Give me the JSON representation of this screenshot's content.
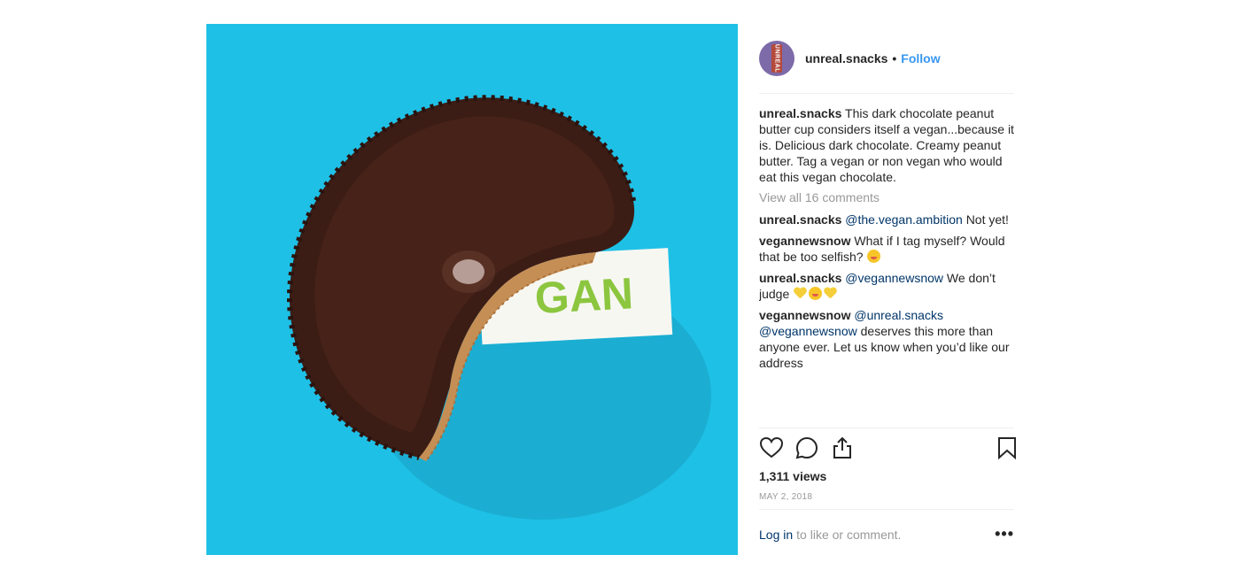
{
  "post": {
    "image_alt_text": "GAN",
    "colors": {
      "background": "#1fc0e6",
      "chocolate": "#3b1d16",
      "peanut_butter": "#c48e55",
      "label_green": "#8cc63f",
      "follow_blue": "#3897f0",
      "mention_blue": "#003569"
    }
  },
  "header": {
    "avatar_text": "UNREAL",
    "username": "unreal.snacks",
    "separator": "•",
    "follow_label": "Follow"
  },
  "caption": {
    "username": "unreal.snacks",
    "text": "This dark chocolate peanut butter cup considers itself a vegan...because it is. Delicious dark chocolate. Creamy peanut butter. Tag a vegan or non vegan who would eat this vegan chocolate."
  },
  "view_all": "View all 16 comments",
  "comments": [
    {
      "username": "unreal.snacks",
      "mention": "@the.vegan.ambition",
      "text": "Not yet!",
      "emoji": []
    },
    {
      "username": "vegannewsnow",
      "mention": "",
      "text": "What if I tag myself? Would that be too selfish?",
      "emoji": [
        "face"
      ]
    },
    {
      "username": "unreal.snacks",
      "mention": "@vegannewsnow",
      "text": "We don’t judge",
      "emoji": [
        "heart",
        "face",
        "heart"
      ]
    },
    {
      "username": "vegannewsnow",
      "mention": "@unreal.snacks @vegannewsnow",
      "text": "deserves this more than anyone ever. Let us know when you’d like our address",
      "emoji": []
    }
  ],
  "actions": {
    "like_icon": "heart-icon",
    "comment_icon": "comment-icon",
    "share_icon": "share-icon",
    "save_icon": "bookmark-icon"
  },
  "views": "1,311 views",
  "date": "MAY 2, 2018",
  "footer": {
    "login_label": "Log in",
    "login_suffix": "to like or comment.",
    "more_label": "•••"
  }
}
